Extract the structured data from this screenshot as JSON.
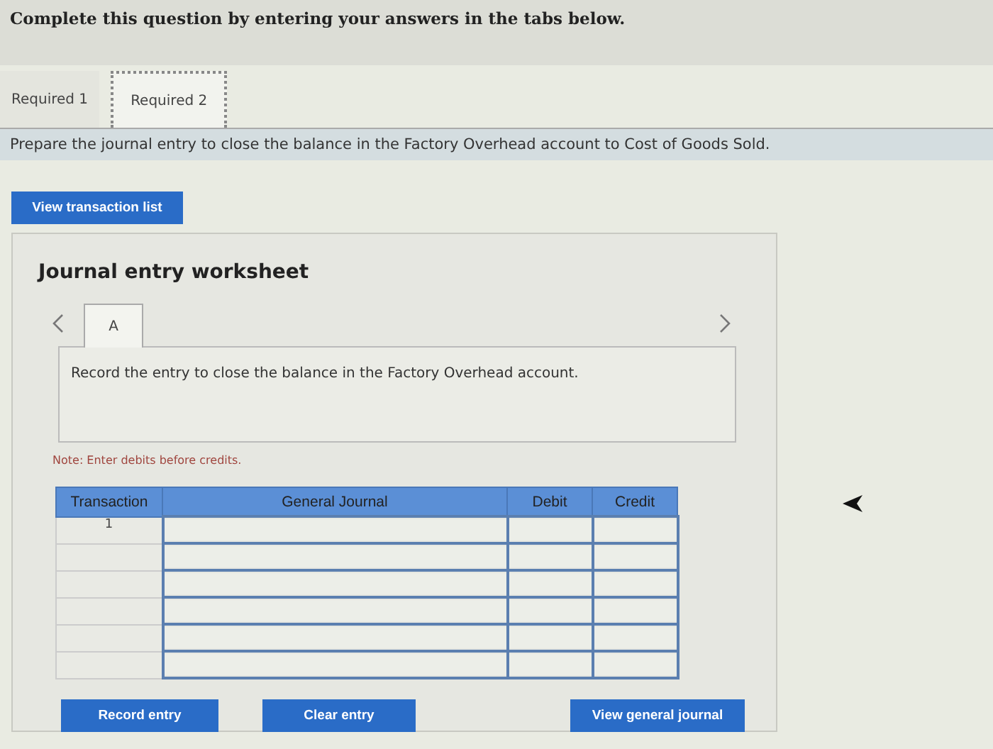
{
  "instruction": "Complete this question by entering your answers in the tabs below.",
  "tabs": [
    {
      "label": "Required 1",
      "selected": false
    },
    {
      "label": "Required 2",
      "selected": true
    }
  ],
  "prompt": "Prepare the journal entry to close the balance in the Factory Overhead account to Cost of Goods Sold.",
  "view_transactions_button": "View transaction list",
  "worksheet": {
    "title": "Journal entry worksheet",
    "entry_tabs": [
      {
        "label": "A",
        "selected": true
      }
    ],
    "entry_description": "Record the entry to close the balance in the Factory Overhead account.",
    "note": "Note: Enter debits before credits.",
    "table": {
      "columns": [
        "Transaction",
        "General Journal",
        "Debit",
        "Credit"
      ],
      "rows": [
        {
          "transaction": "1"
        },
        {},
        {},
        {},
        {},
        {}
      ]
    },
    "buttons": [
      "Record entry",
      "Clear entry",
      "View general journal"
    ]
  }
}
